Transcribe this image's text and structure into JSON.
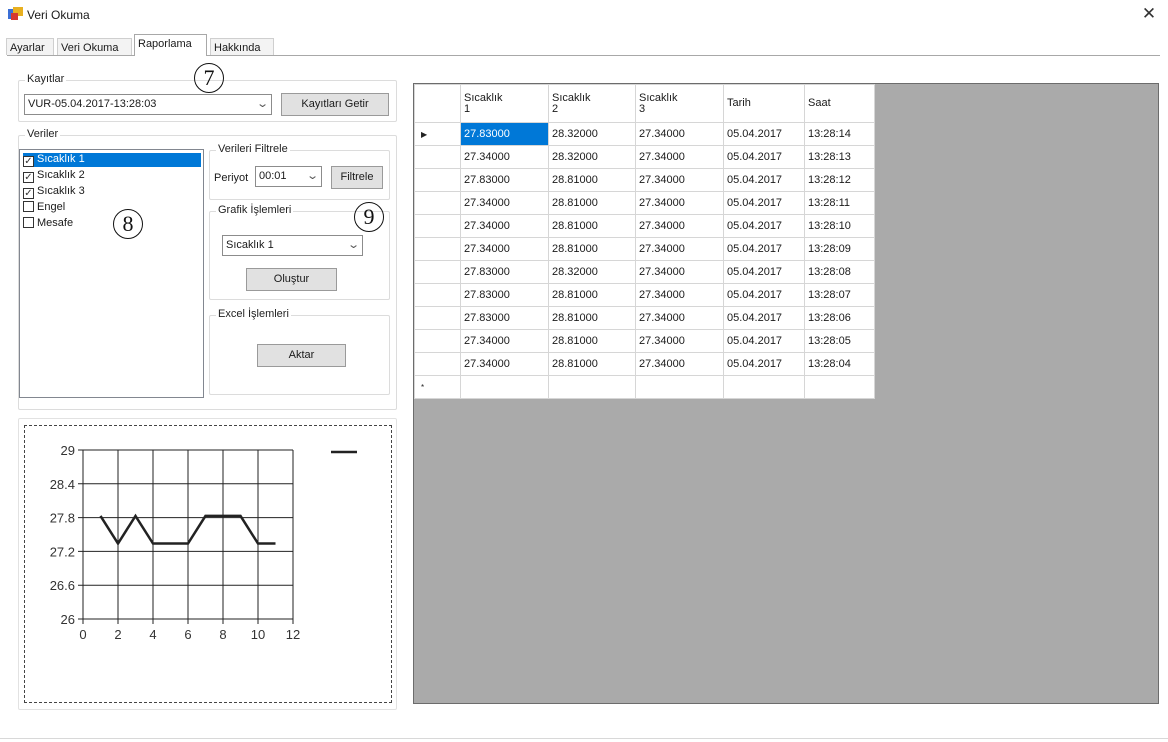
{
  "window": {
    "title": "Veri Okuma",
    "close_glyph": "✕",
    "icon": "app-icon"
  },
  "tabs": [
    {
      "label": "Ayarlar",
      "active": false
    },
    {
      "label": "Veri Okuma",
      "active": false
    },
    {
      "label": "Raporlama",
      "active": true
    },
    {
      "label": "Hakkında",
      "active": false
    }
  ],
  "kayitlar": {
    "group_title": "Kayıtlar",
    "selected_record": "VUR-05.04.2017-13:28:03",
    "fetch_button": "Kayıtları Getir"
  },
  "veriler": {
    "group_title": "Veriler",
    "items": [
      {
        "label": "Sıcaklık 1",
        "checked": true,
        "selected": true
      },
      {
        "label": "Sıcaklık 2",
        "checked": true,
        "selected": false
      },
      {
        "label": "Sıcaklık 3",
        "checked": true,
        "selected": false
      },
      {
        "label": "Engel",
        "checked": false,
        "selected": false
      },
      {
        "label": "Mesafe",
        "checked": false,
        "selected": false
      }
    ]
  },
  "filter": {
    "group_title": "Verileri Filtrele",
    "period_label": "Periyot",
    "period_value": "00:01",
    "filter_button": "Filtrele"
  },
  "graph_ops": {
    "group_title": "Grafik İşlemleri",
    "series_value": "Sıcaklık 1",
    "create_button": "Oluştur"
  },
  "excel_ops": {
    "group_title": "Excel İşlemleri",
    "export_button": "Aktar"
  },
  "annotations": {
    "seven": "7",
    "eight": "8",
    "nine": "9"
  },
  "grid": {
    "columns": [
      "Sıcaklık\n1",
      "Sıcaklık\n2",
      "Sıcaklık\n3",
      "Tarih",
      "Saat"
    ],
    "current_row_marker": "▶",
    "new_row_marker": "*",
    "rows": [
      [
        "27.83000",
        "28.32000",
        "27.34000",
        "05.04.2017",
        "13:28:14"
      ],
      [
        "27.34000",
        "28.32000",
        "27.34000",
        "05.04.2017",
        "13:28:13"
      ],
      [
        "27.83000",
        "28.81000",
        "27.34000",
        "05.04.2017",
        "13:28:12"
      ],
      [
        "27.34000",
        "28.81000",
        "27.34000",
        "05.04.2017",
        "13:28:11"
      ],
      [
        "27.34000",
        "28.81000",
        "27.34000",
        "05.04.2017",
        "13:28:10"
      ],
      [
        "27.34000",
        "28.81000",
        "27.34000",
        "05.04.2017",
        "13:28:09"
      ],
      [
        "27.83000",
        "28.32000",
        "27.34000",
        "05.04.2017",
        "13:28:08"
      ],
      [
        "27.83000",
        "28.81000",
        "27.34000",
        "05.04.2017",
        "13:28:07"
      ],
      [
        "27.83000",
        "28.81000",
        "27.34000",
        "05.04.2017",
        "13:28:06"
      ],
      [
        "27.34000",
        "28.81000",
        "27.34000",
        "05.04.2017",
        "13:28:05"
      ],
      [
        "27.34000",
        "28.81000",
        "27.34000",
        "05.04.2017",
        "13:28:04"
      ]
    ]
  },
  "chart_data": {
    "type": "line",
    "x": [
      1,
      2,
      3,
      4,
      5,
      6,
      7,
      8,
      9,
      10,
      11
    ],
    "series": [
      {
        "values": [
          27.83,
          27.34,
          27.83,
          27.34,
          27.34,
          27.34,
          27.83,
          27.83,
          27.83,
          27.34,
          27.34
        ]
      }
    ],
    "xticks": [
      "0",
      "2",
      "4",
      "6",
      "8",
      "10",
      "12"
    ],
    "yticks": [
      "26",
      "26.6",
      "27.2",
      "27.8",
      "28.4",
      "29"
    ],
    "xlim": [
      0,
      12
    ],
    "ylim": [
      26,
      29
    ],
    "grid": true,
    "legend": "top-right",
    "title": "",
    "xlabel": "",
    "ylabel": ""
  },
  "colors": {
    "selection": "#0078d7",
    "grid_background": "#aaaaaa",
    "series_line": "#222222"
  }
}
